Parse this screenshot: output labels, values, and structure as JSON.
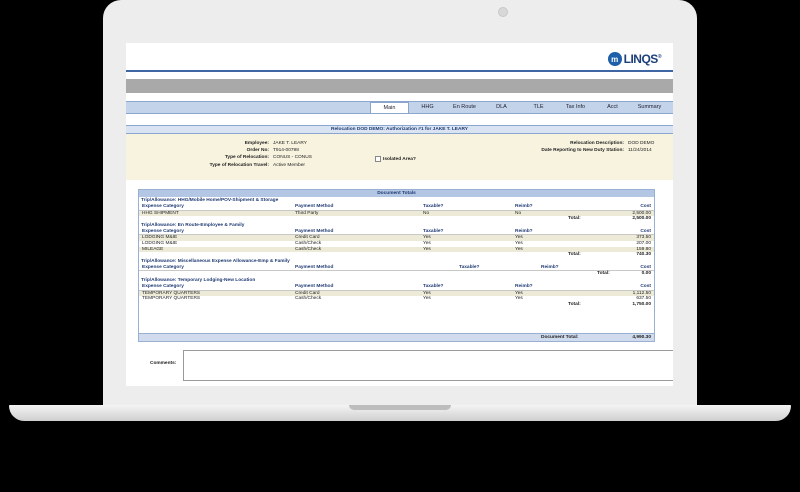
{
  "brand": {
    "logo_mark": "m",
    "logo_text": "LINQS",
    "logo_reg": "®"
  },
  "tabs": [
    {
      "label": "Main",
      "active": true
    },
    {
      "label": "HHG"
    },
    {
      "label": "En Route"
    },
    {
      "label": "DLA"
    },
    {
      "label": "TLE"
    },
    {
      "label": "Tax Info"
    },
    {
      "label": "Acct"
    },
    {
      "label": "Summary"
    }
  ],
  "header": {
    "title": "Relocation DOD DEMO: Authorization #1 for JAKE T. LEARY",
    "employee_label": "Employee:",
    "employee": "JAKE T. LEARY",
    "order_label": "Order No:",
    "order": "T914-00798",
    "type_label": "Type of Relocation:",
    "type": "CONUS - CONUS",
    "travel_label": "Type of Relocation Travel:",
    "travel": "Active Member",
    "isolated_label": "Isolated Area?",
    "desc_label": "Relocation Description:",
    "desc": "DOD DEMO",
    "report_label": "Date Reporting to New Duty Station:",
    "report": "11/24/2014"
  },
  "totals": {
    "title": "Document Totals",
    "columns": {
      "category": "Expense Category",
      "method": "Payment Method",
      "taxable": "Taxable?",
      "reimb": "Reimb?",
      "cost": "Cost"
    },
    "total_label": "Total:",
    "groups": [
      {
        "trip": "Trip/Allowance:  HHG/Mobile Home/POV-Shipment & Storage",
        "rows": [
          {
            "category": "HHG SHIPMENT",
            "method": "Third Party",
            "taxable": "No",
            "reimb": "No",
            "cost": "2,500.00"
          }
        ],
        "total": "2,500.00"
      },
      {
        "trip": "Trip/Allowance:  En Route-Employee & Family",
        "rows": [
          {
            "category": "LODGING M&IE",
            "method": "Credit Card",
            "taxable": "Yes",
            "reimb": "Yes",
            "cost": "373.50"
          },
          {
            "category": "LODGING M&IE",
            "method": "Cash/Check",
            "taxable": "Yes",
            "reimb": "Yes",
            "cost": "207.00"
          },
          {
            "category": "MILEAGE",
            "method": "Cash/Check",
            "taxable": "Yes",
            "reimb": "Yes",
            "cost": "159.80"
          }
        ],
        "total": "740.30"
      },
      {
        "trip": "Trip/Allowance:  Miscellaneous Expense Allowance-Emp & Family",
        "rows": [],
        "total": "0.00"
      },
      {
        "trip": "Trip/Allowance:  Temporary Lodging-New Location",
        "rows": [
          {
            "category": "TEMPORARY QUARTERS",
            "method": "Credit Card",
            "taxable": "Yes",
            "reimb": "Yes",
            "cost": "1,112.50"
          },
          {
            "category": "TEMPORARY QUARTERS",
            "method": "Cash/Check",
            "taxable": "Yes",
            "reimb": "Yes",
            "cost": "637.50"
          }
        ],
        "total": "1,750.00"
      }
    ],
    "doc_total_label": "Document Total:",
    "doc_total": "4,990.30"
  },
  "comments": {
    "label": "Comments:",
    "value": ""
  }
}
